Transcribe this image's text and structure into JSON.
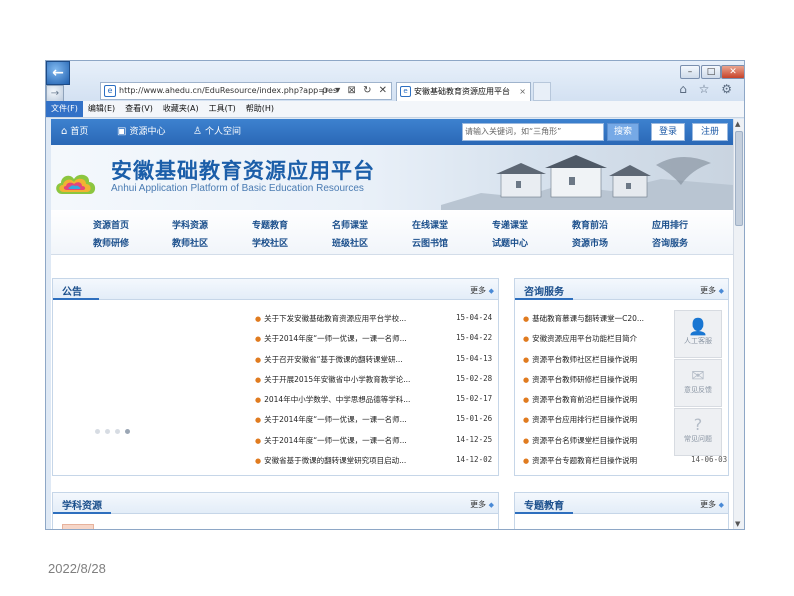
{
  "slide": {
    "date": "2022/8/28"
  },
  "browser": {
    "window_controls": {
      "minimize": "–",
      "maximize": "□",
      "close": "✕"
    },
    "address": {
      "url": "http://www.ahedu.cn/EduResource/index.php?app=reso",
      "tools": "ρ ▾ ⊠ ↻ ✕"
    },
    "tab": {
      "title": "安徽基础教育资源应用平台",
      "close": "×"
    },
    "right_icons": "⌂ ☆ ⚙",
    "menu": [
      "文件(F)",
      "编辑(E)",
      "查看(V)",
      "收藏夹(A)",
      "工具(T)",
      "帮助(H)"
    ]
  },
  "site": {
    "nav": [
      {
        "label": "首页",
        "icon": "home-icon",
        "glyph": "⌂"
      },
      {
        "label": "资源中心",
        "icon": "resource-icon",
        "glyph": "▣"
      },
      {
        "label": "个人空间",
        "icon": "person-icon",
        "glyph": "♙"
      }
    ],
    "search": {
      "placeholder": "请输入关键词，如“三角形”",
      "button": "搜索"
    },
    "login": "登录",
    "register": "注册",
    "banner": {
      "title": "安徽基础教育资源应用平台",
      "subtitle": "Anhui Application Platform of Basic Education Resources"
    },
    "channels": [
      [
        "资源首页",
        "学科资源",
        "专题教育",
        "名师课堂",
        "在线课堂",
        "专递课堂",
        "教育前沿",
        "应用排行"
      ],
      [
        "教师研修",
        "教师社区",
        "学校社区",
        "班级社区",
        "云图书馆",
        "试题中心",
        "资源市场",
        "咨询服务"
      ]
    ],
    "notice": {
      "title": "公告",
      "more": "更多",
      "items": [
        {
          "text": "关于下发安徽基础教育资源应用平台学校...",
          "date": "15-04-24"
        },
        {
          "text": "关于2014年度“一师一优课，一课一名师...",
          "date": "15-04-22"
        },
        {
          "text": "关于召开安徽省“基于微课的翻转课堂研...",
          "date": "15-04-13"
        },
        {
          "text": "关于开展2015年安徽省中小学教育教学论...",
          "date": "15-02-28"
        },
        {
          "text": "2014年中小学数学、中学思想品德等学科...",
          "date": "15-02-17"
        },
        {
          "text": "关于2014年度“一师一优课，一课一名师...",
          "date": "15-01-26"
        },
        {
          "text": "关于2014年度“一师一优课，一课一名师...",
          "date": "14-12-25"
        },
        {
          "text": "安徽省基于微课的翻转课堂研究项目启动...",
          "date": "14-12-02"
        }
      ]
    },
    "consult": {
      "title": "咨询服务",
      "more": "更多",
      "items": [
        "基础教育慕课与翻转课堂一C20...",
        "安徽资源应用平台功能栏目简介",
        "资源平台教师社区栏目操作说明",
        "资源平台教师研修栏目操作说明",
        "资源平台教育前沿栏目操作说明",
        "资源平台应用排行栏目操作说明",
        "资源平台名师课堂栏目操作说明",
        "资源平台专题教育栏目操作说明"
      ],
      "partial_date": "14-06-03"
    },
    "float_tools": [
      {
        "label": "人工客服",
        "icon": "person-icon",
        "glyph": "👤"
      },
      {
        "label": "意见反馈",
        "icon": "feedback-icon",
        "glyph": "✉"
      },
      {
        "label": "常见问题",
        "icon": "question-icon",
        "glyph": "?"
      }
    ],
    "subject": {
      "title": "学科资源",
      "more": "更多"
    },
    "topic": {
      "title": "专题教育",
      "more": "更多"
    }
  }
}
